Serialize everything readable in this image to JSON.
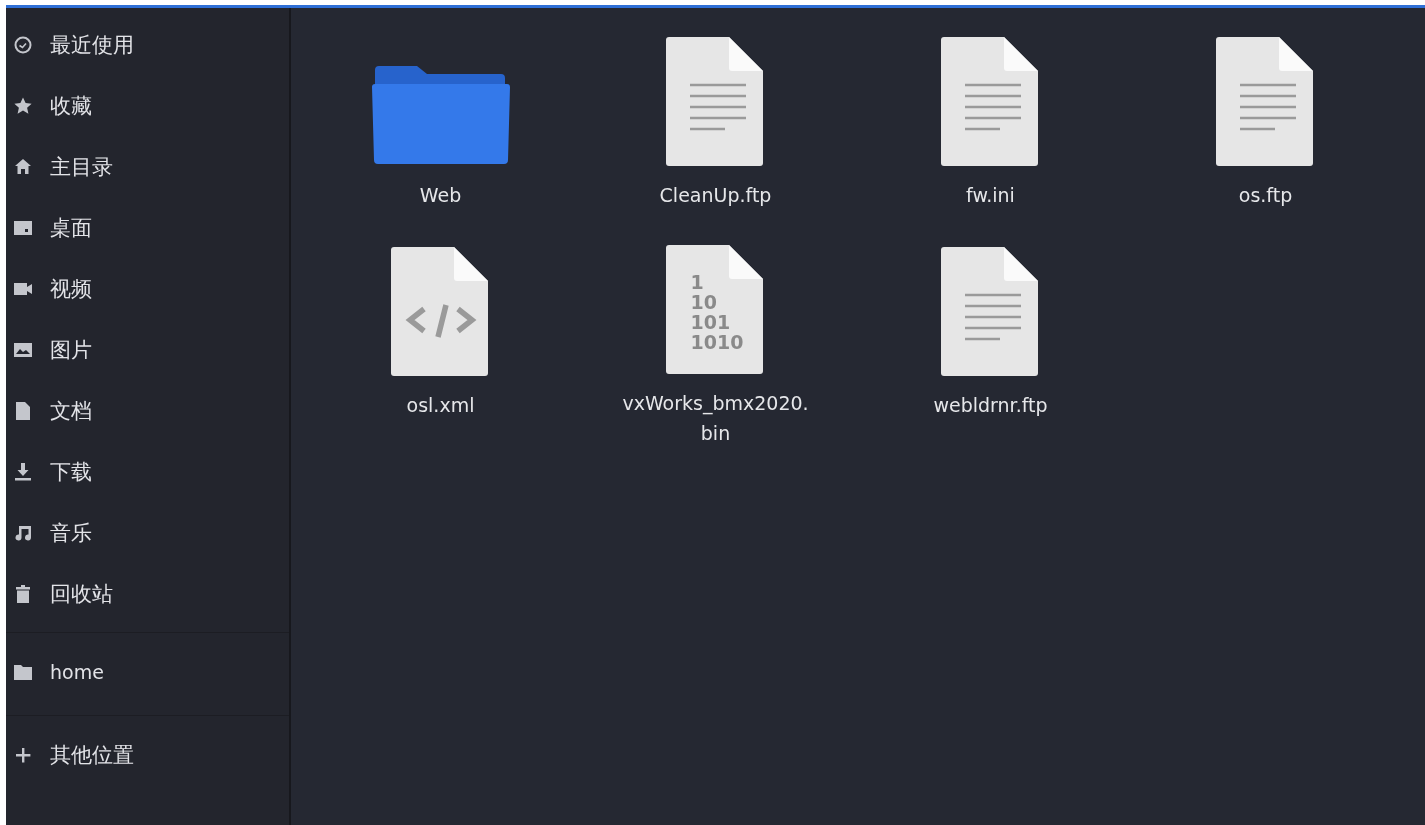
{
  "sidebar": {
    "groups": [
      {
        "items": [
          {
            "kind": "clock",
            "label": "最近使用"
          },
          {
            "kind": "star",
            "label": "收藏"
          },
          {
            "kind": "home",
            "label": "主目录"
          },
          {
            "kind": "desktop",
            "label": "桌面"
          },
          {
            "kind": "video",
            "label": "视频"
          },
          {
            "kind": "image",
            "label": "图片"
          },
          {
            "kind": "document",
            "label": "文档"
          },
          {
            "kind": "download",
            "label": "下载"
          },
          {
            "kind": "music",
            "label": "音乐"
          },
          {
            "kind": "trash",
            "label": "回收站"
          }
        ]
      },
      {
        "items": [
          {
            "kind": "folder",
            "label": "home"
          }
        ]
      },
      {
        "items": [
          {
            "kind": "plus",
            "label": "其他位置"
          }
        ]
      }
    ]
  },
  "files": [
    {
      "kind": "folder",
      "name": "Web"
    },
    {
      "kind": "text",
      "name": "CleanUp.ftp"
    },
    {
      "kind": "text",
      "name": "fw.ini"
    },
    {
      "kind": "text",
      "name": "os.ftp"
    },
    {
      "kind": "code",
      "name": "osl.xml"
    },
    {
      "kind": "binary",
      "name": "vxWorks_bmx2020.bin",
      "icon_lines": [
        "1",
        "10",
        "101",
        "1010"
      ]
    },
    {
      "kind": "text",
      "name": "webldrnr.ftp"
    }
  ]
}
